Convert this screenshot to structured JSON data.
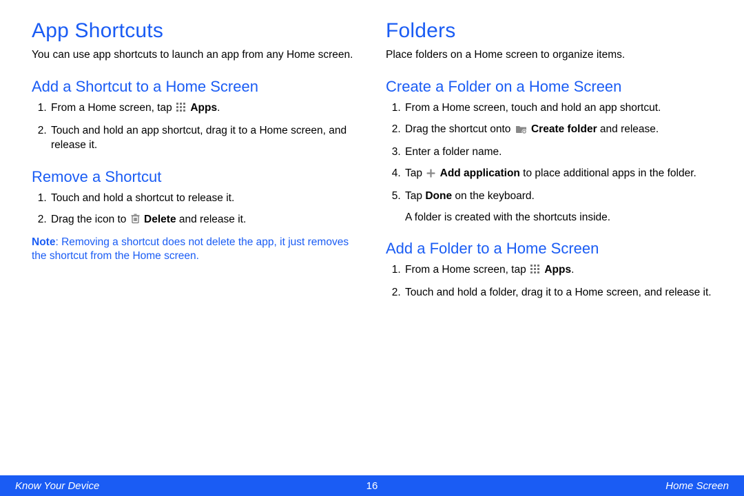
{
  "left": {
    "h1": "App Shortcuts",
    "intro": "You can use app shortcuts to launch an app from any Home screen.",
    "add": {
      "title": "Add a Shortcut to a Home Screen",
      "step1a": "From a Home screen, tap ",
      "step1b": "Apps",
      "step1c": ".",
      "step2": "Touch and hold an app shortcut, drag it to a Home screen, and release it."
    },
    "remove": {
      "title": "Remove a Shortcut",
      "step1": "Touch and hold a shortcut to release it.",
      "step2a": "Drag the icon to ",
      "step2b": "Delete",
      "step2c": " and release it.",
      "noteLabel": "Note",
      "noteBody": ": Removing a shortcut does not delete the app, it just removes the shortcut from the Home screen."
    }
  },
  "right": {
    "h1": "Folders",
    "intro": "Place folders on a Home screen to organize items.",
    "create": {
      "title": "Create a Folder on a Home Screen",
      "step1": "From a Home screen, touch and hold an app shortcut.",
      "step2a": "Drag the shortcut onto ",
      "step2b": "Create folder",
      "step2c": " and release.",
      "step3": "Enter a folder name.",
      "step4a": "Tap ",
      "step4b": "Add application",
      "step4c": " to place additional apps in the folder.",
      "step5a": "Tap ",
      "step5b": "Done",
      "step5c": " on the keyboard.",
      "result": "A folder is created with the shortcuts inside."
    },
    "addFolder": {
      "title": "Add a Folder to a Home Screen",
      "step1a": "From a Home screen, tap ",
      "step1b": "Apps",
      "step1c": ".",
      "step2": "Touch and hold a folder, drag it to a Home screen, and release it."
    }
  },
  "footer": {
    "left": "Know Your Device",
    "center": "16",
    "right": "Home Screen"
  }
}
